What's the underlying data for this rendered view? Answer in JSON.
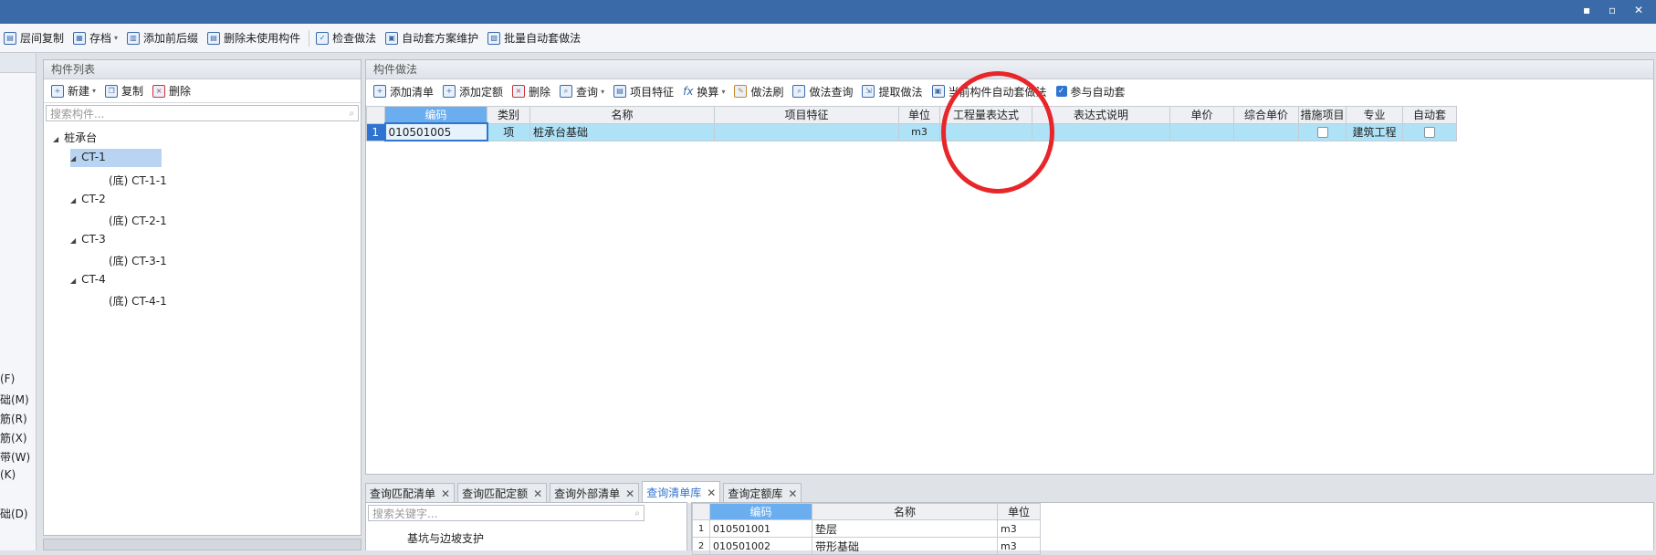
{
  "window": {
    "minimize": "▪",
    "restore": "▫",
    "close": "✕"
  },
  "toolbar": {
    "items": [
      {
        "label": "层间复制",
        "icon": "copy-floors-icon"
      },
      {
        "label": "存档",
        "icon": "archive-icon"
      },
      {
        "label": "添加前后缀",
        "icon": "add-prefix-icon"
      },
      {
        "label": "删除未使用构件",
        "icon": "delete-unused-icon"
      },
      {
        "label": "检查做法",
        "icon": "check-method-icon"
      },
      {
        "label": "自动套方案维护",
        "icon": "auto-scheme-icon"
      },
      {
        "label": "批量自动套做法",
        "icon": "batch-auto-icon"
      }
    ]
  },
  "left_strip": {
    "labels": [
      "(F)",
      "础(M)",
      "筋(R)",
      "筋(X)",
      "带(W)",
      "(K)",
      "础(D)"
    ]
  },
  "component_list": {
    "title": "构件列表",
    "toolbar": {
      "new": "新建",
      "copy": "复制",
      "delete": "删除"
    },
    "search_placeholder": "搜索构件...",
    "tree": [
      {
        "label": "桩承台",
        "level": 0
      },
      {
        "label": "CT-1",
        "level": 1,
        "selected": true
      },
      {
        "label": "(底) CT-1-1",
        "level": 2
      },
      {
        "label": "CT-2",
        "level": 1
      },
      {
        "label": "(底) CT-2-1",
        "level": 2
      },
      {
        "label": "CT-3",
        "level": 1
      },
      {
        "label": "(底) CT-3-1",
        "level": 2
      },
      {
        "label": "CT-4",
        "level": 1
      },
      {
        "label": "(底) CT-4-1",
        "level": 2
      }
    ]
  },
  "method_panel": {
    "title": "构件做法",
    "toolbar": {
      "add_list": "添加清单",
      "add_quota": "添加定额",
      "delete": "删除",
      "query": "查询",
      "item_feature": "项目特征",
      "convert": "换算",
      "method_brush": "做法刷",
      "method_query": "做法查询",
      "extract_method": "提取做法",
      "current_auto": "当前构件自动套做法",
      "join_auto": "参与自动套"
    },
    "columns": [
      "编码",
      "类别",
      "名称",
      "项目特征",
      "单位",
      "工程量表达式",
      "表达式说明",
      "单价",
      "综合单价",
      "措施项目",
      "专业",
      "自动套"
    ],
    "rows": [
      {
        "num": "1",
        "code": "010501005",
        "type": "项",
        "name": "桩承台基础",
        "feature": "",
        "unit": "m3",
        "expr": "",
        "expr_desc": "",
        "price": "",
        "total_price": "",
        "measure": false,
        "major": "建筑工程",
        "auto": false
      }
    ]
  },
  "bottom_tabs": [
    {
      "label": "查询匹配清单",
      "active": false
    },
    {
      "label": "查询匹配定额",
      "active": false
    },
    {
      "label": "查询外部清单",
      "active": false
    },
    {
      "label": "查询清单库",
      "active": true
    },
    {
      "label": "查询定额库",
      "active": false
    }
  ],
  "library": {
    "search_placeholder": "搜索关键字...",
    "tree_item": "基坑与边坡支护",
    "columns": [
      "编码",
      "名称",
      "单位"
    ],
    "rows": [
      {
        "num": "1",
        "code": "010501001",
        "name": "垫层",
        "unit": "m3"
      },
      {
        "num": "2",
        "code": "010501002",
        "name": "带形基础",
        "unit": "m3"
      }
    ]
  },
  "accent": "#2f74d0",
  "annotation_color": "#e8262a"
}
